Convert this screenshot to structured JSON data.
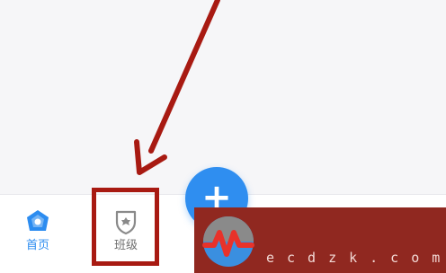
{
  "tabbar": {
    "home_label": "首页",
    "class_label": "班级",
    "add_symbol": "+"
  },
  "watermark": {
    "text": "ecdzk.com"
  },
  "icons": {
    "home": "home-icon",
    "class": "class-shield-icon",
    "add": "plus-icon",
    "logo": "heartbeat-logo-icon"
  },
  "colors": {
    "accent_blue": "#2f8ef0",
    "annotation_red": "#a81a12",
    "watermark_bg": "#902820",
    "tab_inactive": "#6f6f6f"
  }
}
